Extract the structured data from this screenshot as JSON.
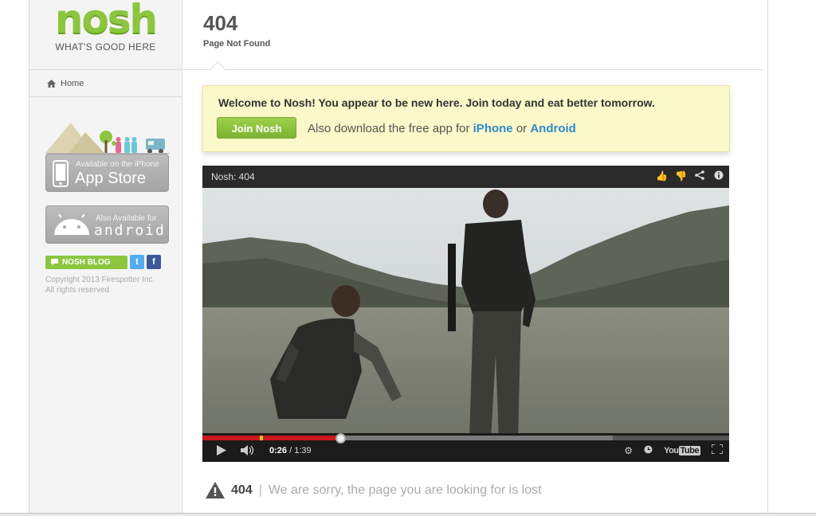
{
  "sidebar": {
    "logo": "nosh",
    "tagline": "WHAT'S GOOD HERE",
    "home_label": "Home",
    "appstore": {
      "small": "Available on the iPhone",
      "big": "App Store"
    },
    "android": {
      "small": "Also Available for",
      "big": "android"
    },
    "blog_label": "NOSH BLOG",
    "twitter_glyph": "t",
    "facebook_glyph": "f",
    "copyright_line1": "Copyright 2013 Firespotter Inc.",
    "copyright_line2": "All rights reserved"
  },
  "header": {
    "code": "404",
    "subtitle": "Page Not Found"
  },
  "welcome": {
    "message": "Welcome to Nosh! You appear to be new here. Join today and eat better tomorrow.",
    "join_label": "Join Nosh",
    "download_prefix": "Also download the free app for",
    "iphone_link": "iPhone",
    "or_text": "or",
    "android_link": "Android"
  },
  "video": {
    "title": "Nosh: 404",
    "current_time": "0:26",
    "separator": "/",
    "duration": "1:39",
    "progress_fraction": 0.263,
    "youtube_label": "You",
    "youtube_tube": "Tube"
  },
  "lost": {
    "code": "404",
    "separator": "|",
    "message": "We are sorry, the page you are looking for is lost"
  },
  "colors": {
    "brand_green": "#8cc63f",
    "link_blue": "#2e8bcc",
    "notice_bg": "#fbf8c9",
    "progress_red": "#cc181e"
  }
}
